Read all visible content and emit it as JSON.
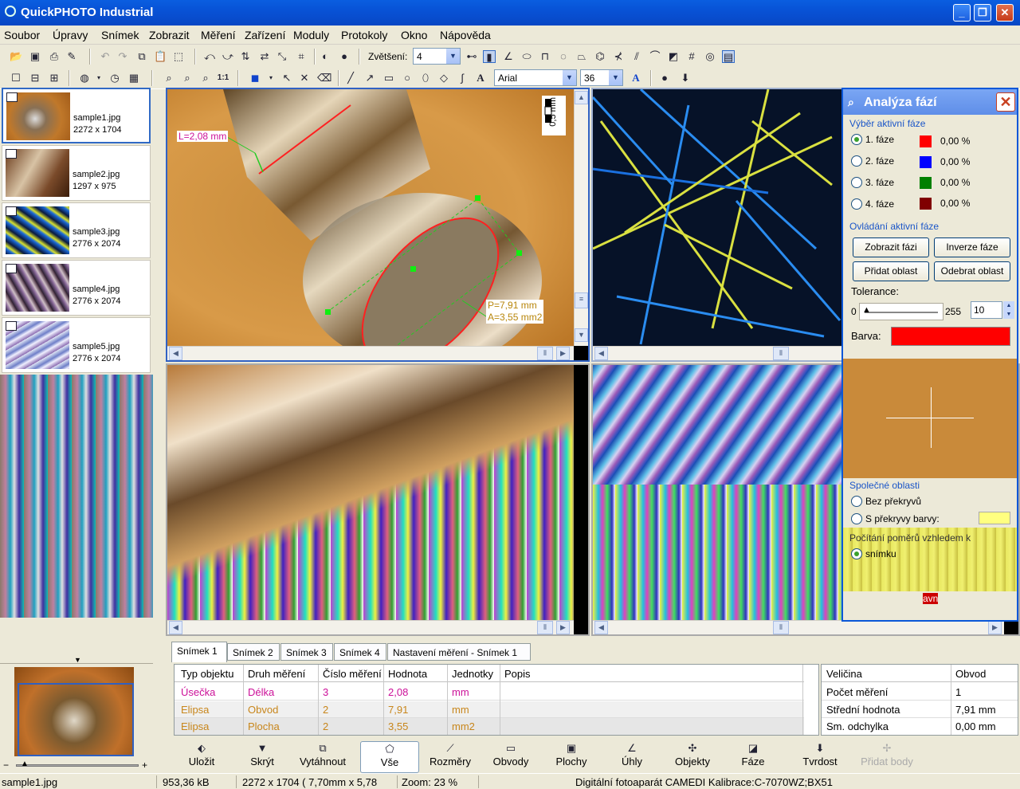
{
  "window": {
    "title": "QuickPHOTO Industrial"
  },
  "menu": [
    "Soubor",
    "Úpravy",
    "Snímek",
    "Zobrazit",
    "Měření",
    "Zařízení",
    "Moduly",
    "Protokoly",
    "Okno",
    "Nápověda"
  ],
  "toolbar": {
    "zoom_label": "Zvětšení:",
    "zoom_value": "4",
    "font_name": "Arial",
    "font_size": "36",
    "one_to_one": "1:1"
  },
  "thumbnails": [
    {
      "name": "sample1.jpg",
      "dims": "2272 x 1704"
    },
    {
      "name": "sample2.jpg",
      "dims": "1297 x 975"
    },
    {
      "name": "sample3.jpg",
      "dims": "2776 x 2074"
    },
    {
      "name": "sample4.jpg",
      "dims": "2776 x 2074"
    },
    {
      "name": "sample5.jpg",
      "dims": "2776 x 2074"
    }
  ],
  "overlay": {
    "length_label": "L=2,08 mm",
    "perimeter_label": "P=7,91 mm",
    "area_label": "A=3,55 mm2",
    "scale_label": "0,5 mm"
  },
  "phase_panel": {
    "title": "Analýza fází",
    "active_group": "Výběr aktivní fáze",
    "phases": [
      {
        "label": "1. fáze",
        "color": "#ff0000",
        "pct": "0,00 %"
      },
      {
        "label": "2. fáze",
        "color": "#0000ff",
        "pct": "0,00 %"
      },
      {
        "label": "3. fáze",
        "color": "#008000",
        "pct": "0,00 %"
      },
      {
        "label": "4. fáze",
        "color": "#800000",
        "pct": "0,00 %"
      }
    ],
    "control_group": "Ovládání aktivní fáze",
    "btn_show": "Zobrazit fázi",
    "btn_invert": "Inverze fáze",
    "btn_add": "Přidat oblast",
    "btn_remove": "Odebrat oblast",
    "tolerance_label": "Tolerance:",
    "tol_min": "0",
    "tol_max": "255",
    "tol_value": "10",
    "color_label": "Barva:",
    "common_group": "Společné oblasti",
    "no_overlap": "Bez překryvů",
    "overlap_color": "S překryvy barvy:",
    "ratio_group": "Počítání poměrů vzhledem k",
    "ratio_image": "snímku",
    "fragment": "avn"
  },
  "tabs": [
    "Snímek 1",
    "Snímek 2",
    "Snímek 3",
    "Snímek 4",
    "Nastavení měření - Snímek 1"
  ],
  "measure_table": {
    "headers": [
      "Typ objektu",
      "Druh měření",
      "Číslo měření",
      "Hodnota",
      "Jednotky",
      "Popis"
    ],
    "rows": [
      [
        "Úsečka",
        "Délka",
        "3",
        "2,08",
        "mm",
        ""
      ],
      [
        "Elipsa",
        "Obvod",
        "2",
        "7,91",
        "mm",
        ""
      ],
      [
        "Elipsa",
        "Plocha",
        "2",
        "3,55",
        "mm2",
        ""
      ]
    ]
  },
  "stats_table": {
    "headers": [
      "Veličina",
      "Obvod"
    ],
    "rows": [
      [
        "Počet měření",
        "1"
      ],
      [
        "Střední hodnota",
        "7,91 mm"
      ],
      [
        "Sm. odchylka",
        "0,00 mm"
      ]
    ]
  },
  "bottom_buttons": [
    "Uložit",
    "Skrýt",
    "Vytáhnout",
    "Vše",
    "Rozměry",
    "Obvody",
    "Plochy",
    "Úhly",
    "Objekty",
    "Fáze",
    "Tvrdost",
    "Přidat body"
  ],
  "status": {
    "file": "sample1.jpg",
    "size": "953,36 kB",
    "dims": "2272 x 1704 ( 7,70mm x  5,78",
    "zoom": "Zoom: 23 %",
    "camera": "Digitální fotoaparát CAMEDI Kalibrace:C-7070WZ;BX51"
  }
}
